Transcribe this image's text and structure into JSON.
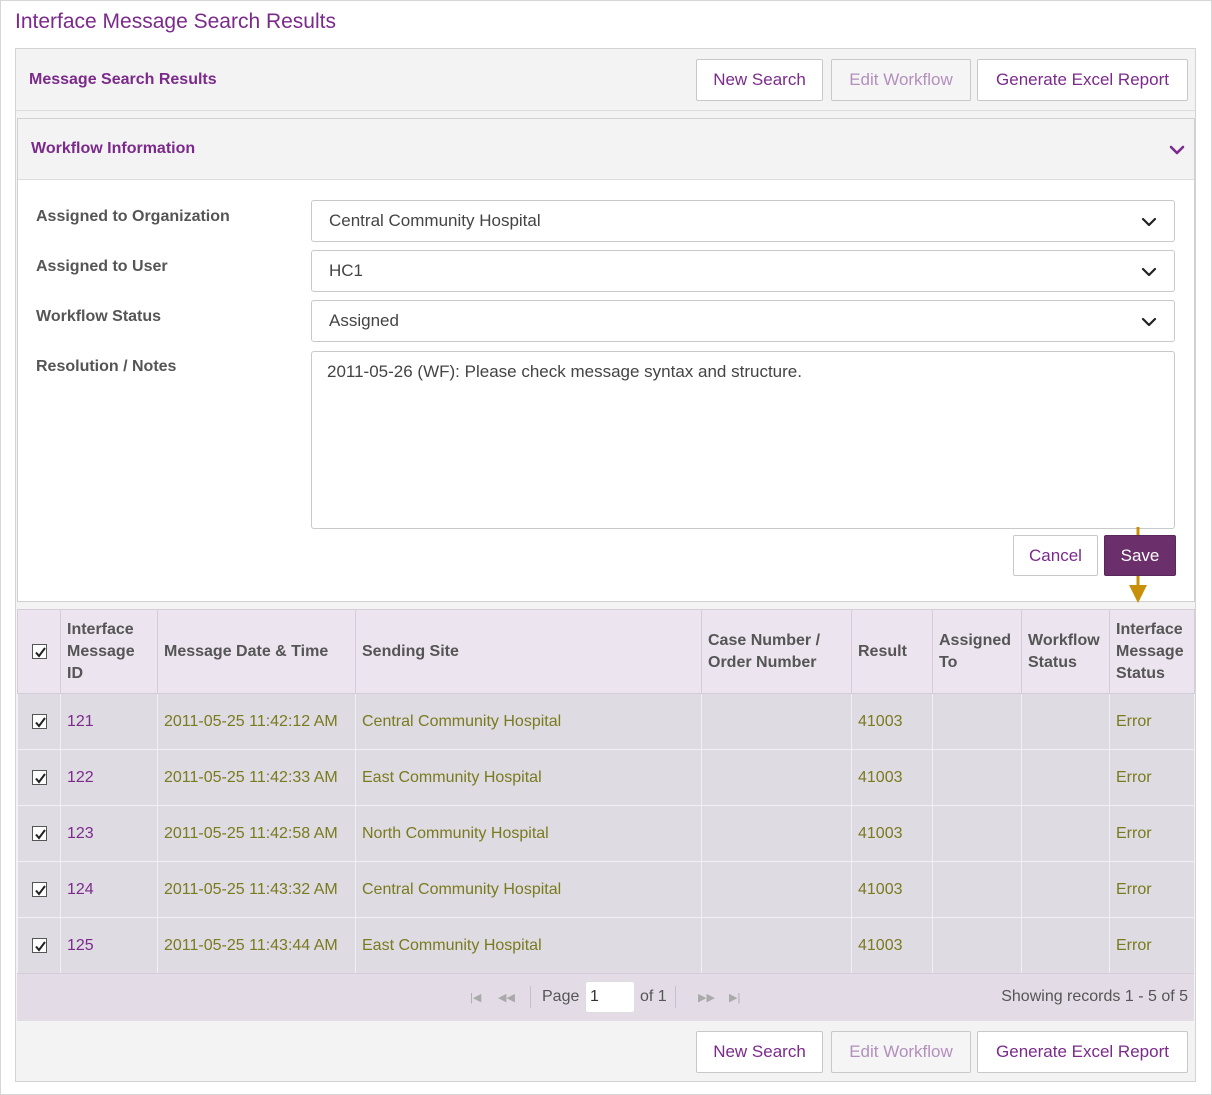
{
  "page": {
    "title": "Interface Message Search Results"
  },
  "toolbar": {
    "title": "Message Search Results",
    "new_search": "New Search",
    "edit_workflow": "Edit Workflow",
    "generate_report": "Generate Excel Report"
  },
  "workflow": {
    "title": "Workflow Information",
    "org_label": "Assigned to Organization",
    "org_value": "Central Community Hospital",
    "user_label": "Assigned to User",
    "user_value": "HC1",
    "status_label": "Workflow Status",
    "status_value": "Assigned",
    "notes_label": "Resolution / Notes",
    "notes_value": "2011-05-26 (WF): Please check message syntax and structure.",
    "cancel": "Cancel",
    "save": "Save"
  },
  "table": {
    "headers": [
      "Interface Message ID",
      "Message Date & Time",
      "Sending Site",
      "Case Number / Order Number",
      "Result",
      "Assigned To",
      "Workflow Status",
      "Interface Message Status"
    ],
    "rows": [
      {
        "id": "121",
        "datetime": "2011-05-25 11:42:12 AM",
        "site": "Central Community Hospital",
        "case": "",
        "result": "41003",
        "assigned": "",
        "wf_status": "",
        "msg_status": "Error"
      },
      {
        "id": "122",
        "datetime": "2011-05-25 11:42:33 AM",
        "site": "East Community Hospital",
        "case": "",
        "result": "41003",
        "assigned": "",
        "wf_status": "",
        "msg_status": "Error"
      },
      {
        "id": "123",
        "datetime": "2011-05-25 11:42:58 AM",
        "site": "North Community Hospital",
        "case": "",
        "result": "41003",
        "assigned": "",
        "wf_status": "",
        "msg_status": "Error"
      },
      {
        "id": "124",
        "datetime": "2011-05-25 11:43:32 AM",
        "site": "Central Community Hospital",
        "case": "",
        "result": "41003",
        "assigned": "",
        "wf_status": "",
        "msg_status": "Error"
      },
      {
        "id": "125",
        "datetime": "2011-05-25 11:43:44 AM",
        "site": "East Community Hospital",
        "case": "",
        "result": "41003",
        "assigned": "",
        "wf_status": "",
        "msg_status": "Error"
      }
    ]
  },
  "pager": {
    "page_label": "Page",
    "page_value": "1",
    "of_label": "of 1",
    "records": "Showing records 1 - 5 of 5",
    "first_icon": "first-page-icon",
    "prev_icon": "prev-page-icon",
    "next_icon": "next-page-icon",
    "last_icon": "last-page-icon"
  },
  "colors": {
    "accent": "#7b2a8c",
    "primary_button": "#6b2f6b",
    "annotation_arrow": "#c8900a",
    "data_text": "#7a7a1e"
  }
}
